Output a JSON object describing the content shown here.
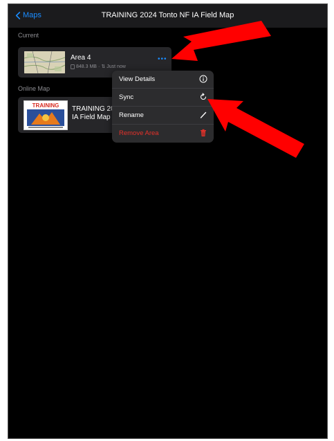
{
  "nav": {
    "back_label": "Maps",
    "title": "TRAINING 2024 Tonto NF IA Field Map"
  },
  "sections": {
    "current": "Current",
    "online": "Online Map"
  },
  "current_area": {
    "name": "Area 4",
    "size": "848.3 MB",
    "separator": "·",
    "sync_status": "Just now"
  },
  "online_map": {
    "name_line1": "TRAINING 20",
    "name_line2": "IA Field Map",
    "thumb_banner": "TRAINING"
  },
  "menu": {
    "items": [
      {
        "label": "View Details",
        "icon": "info-icon"
      },
      {
        "label": "Sync",
        "icon": "sync-icon"
      },
      {
        "label": "Rename",
        "icon": "pencil-icon"
      },
      {
        "label": "Remove Area",
        "icon": "trash-icon"
      }
    ]
  },
  "colors": {
    "accent": "#1a8cff",
    "danger": "#e5312a",
    "annotation": "#ff0000"
  }
}
